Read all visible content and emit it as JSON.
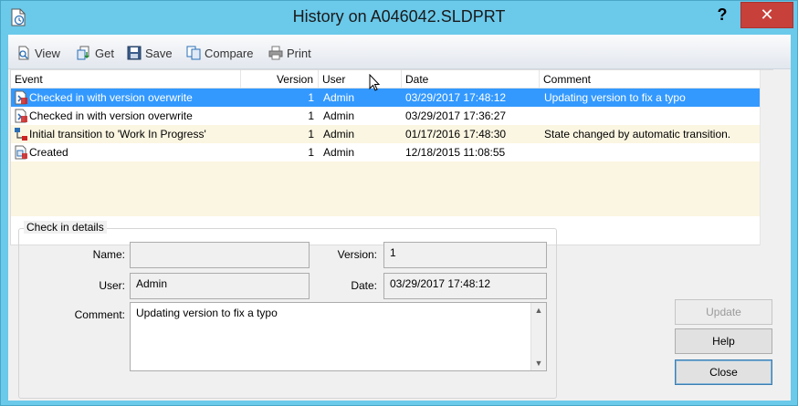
{
  "window": {
    "title": "History on A046042.SLDPRT",
    "help_symbol": "?",
    "close_symbol": "✕"
  },
  "toolbar": {
    "view_label": "View",
    "get_label": "Get",
    "save_label": "Save",
    "compare_label": "Compare",
    "print_label": "Print"
  },
  "history": {
    "columns": [
      "Event",
      "Version",
      "User",
      "Date",
      "Comment"
    ],
    "rows": [
      {
        "event": "Checked in with version overwrite",
        "version": "1",
        "user": "Admin",
        "date": "03/29/2017 17:48:12",
        "comment": "Updating version to fix a typo",
        "icon": "checkin-icon",
        "selected": true
      },
      {
        "event": "Checked in with version overwrite",
        "version": "1",
        "user": "Admin",
        "date": "03/29/2017 17:36:27",
        "comment": "",
        "icon": "checkin-icon",
        "selected": false
      },
      {
        "event": "Initial transition to 'Work In Progress'",
        "version": "1",
        "user": "Admin",
        "date": "01/17/2016 17:48:30",
        "comment": "State changed by automatic transition.",
        "icon": "workflow-icon",
        "selected": false
      },
      {
        "event": "Created",
        "version": "1",
        "user": "Admin",
        "date": "12/18/2015 11:08:55",
        "comment": "",
        "icon": "created-icon",
        "selected": false
      }
    ]
  },
  "details": {
    "group_label": "Check in details",
    "name_label": "Name:",
    "name_value": "",
    "version_label": "Version:",
    "version_value": "1",
    "user_label": "User:",
    "user_value": "Admin",
    "date_label": "Date:",
    "date_value": "03/29/2017 17:48:12",
    "comment_label": "Comment:",
    "comment_value": "Updating version to fix a typo"
  },
  "buttons": {
    "update_label": "Update",
    "help_label": "Help",
    "close_label": "Close"
  },
  "colors": {
    "titlebar": "#6bc9ea",
    "selection": "#3399ff",
    "alt_row": "#fbf6e2",
    "close": "#c7403a"
  }
}
